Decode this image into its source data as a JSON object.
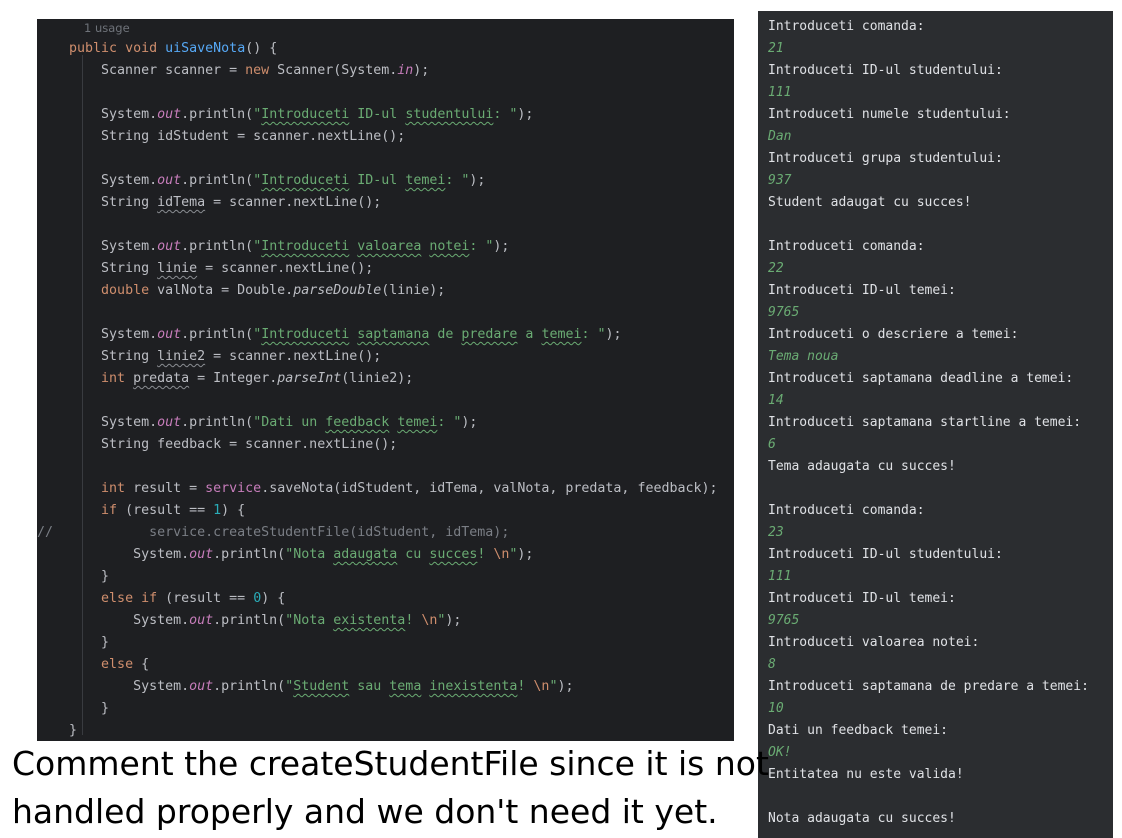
{
  "editor": {
    "usage_hint": "1 usage",
    "lines": [
      "    public void uiSaveNota() {",
      "        Scanner scanner = new Scanner(System.in);",
      "",
      "        System.out.println(\"Introduceti ID-ul studentului: \");",
      "        String idStudent = scanner.nextLine();",
      "",
      "        System.out.println(\"Introduceti ID-ul temei: \");",
      "        String idTema = scanner.nextLine();",
      "",
      "        System.out.println(\"Introduceti valoarea notei: \");",
      "        String linie = scanner.nextLine();",
      "        double valNota = Double.parseDouble(linie);",
      "",
      "        System.out.println(\"Introduceti saptamana de predare a temei: \");",
      "        String linie2 = scanner.nextLine();",
      "        int predata = Integer.parseInt(linie2);",
      "",
      "        System.out.println(\"Dati un feedback temei: \");",
      "        String feedback = scanner.nextLine();",
      "",
      "        int result = service.saveNota(idStudent, idTema, valNota, predata, feedback);",
      "        if (result == 1) {",
      "//            service.createStudentFile(idStudent, idTema);",
      "            System.out.println(\"Nota adaugata cu succes! \\n\");",
      "        }",
      "        else if (result == 0) {",
      "            System.out.println(\"Nota existenta! \\n\");",
      "        }",
      "        else {",
      "            System.out.println(\"Student sau tema inexistenta! \\n\");",
      "        }",
      "    }"
    ]
  },
  "console": {
    "lines": [
      {
        "text": "Introduceti comanda:",
        "input": false
      },
      {
        "text": "21",
        "input": true
      },
      {
        "text": "Introduceti ID-ul studentului:",
        "input": false
      },
      {
        "text": "111",
        "input": true
      },
      {
        "text": "Introduceti numele studentului:",
        "input": false
      },
      {
        "text": "Dan",
        "input": true
      },
      {
        "text": "Introduceti grupa studentului:",
        "input": false
      },
      {
        "text": "937",
        "input": true
      },
      {
        "text": "Student adaugat cu succes!",
        "input": false
      },
      {
        "text": "",
        "input": false
      },
      {
        "text": "Introduceti comanda:",
        "input": false
      },
      {
        "text": "22",
        "input": true
      },
      {
        "text": "Introduceti ID-ul temei:",
        "input": false
      },
      {
        "text": "9765",
        "input": true
      },
      {
        "text": "Introduceti o descriere a temei:",
        "input": false
      },
      {
        "text": "Tema noua",
        "input": true
      },
      {
        "text": "Introduceti saptamana deadline a temei:",
        "input": false
      },
      {
        "text": "14",
        "input": true
      },
      {
        "text": "Introduceti saptamana startline a temei:",
        "input": false
      },
      {
        "text": "6",
        "input": true
      },
      {
        "text": "Tema adaugata cu succes!",
        "input": false
      },
      {
        "text": "",
        "input": false
      },
      {
        "text": "Introduceti comanda:",
        "input": false
      },
      {
        "text": "23",
        "input": true
      },
      {
        "text": "Introduceti ID-ul studentului:",
        "input": false
      },
      {
        "text": "111",
        "input": true
      },
      {
        "text": "Introduceti ID-ul temei:",
        "input": false
      },
      {
        "text": "9765",
        "input": true
      },
      {
        "text": "Introduceti valoarea notei:",
        "input": false
      },
      {
        "text": "8",
        "input": true
      },
      {
        "text": "Introduceti saptamana de predare a temei:",
        "input": false
      },
      {
        "text": "10",
        "input": true
      },
      {
        "text": "Dati un feedback temei:",
        "input": false
      },
      {
        "text": "OK!",
        "input": true
      },
      {
        "text": "Entitatea nu este valida!",
        "input": false
      },
      {
        "text": "",
        "input": false
      },
      {
        "text": "Nota adaugata cu succes!",
        "input": false
      }
    ]
  },
  "caption": {
    "line1": "Comment the createStudentFile since it is not",
    "line2": "handled properly and we don't need it yet."
  }
}
